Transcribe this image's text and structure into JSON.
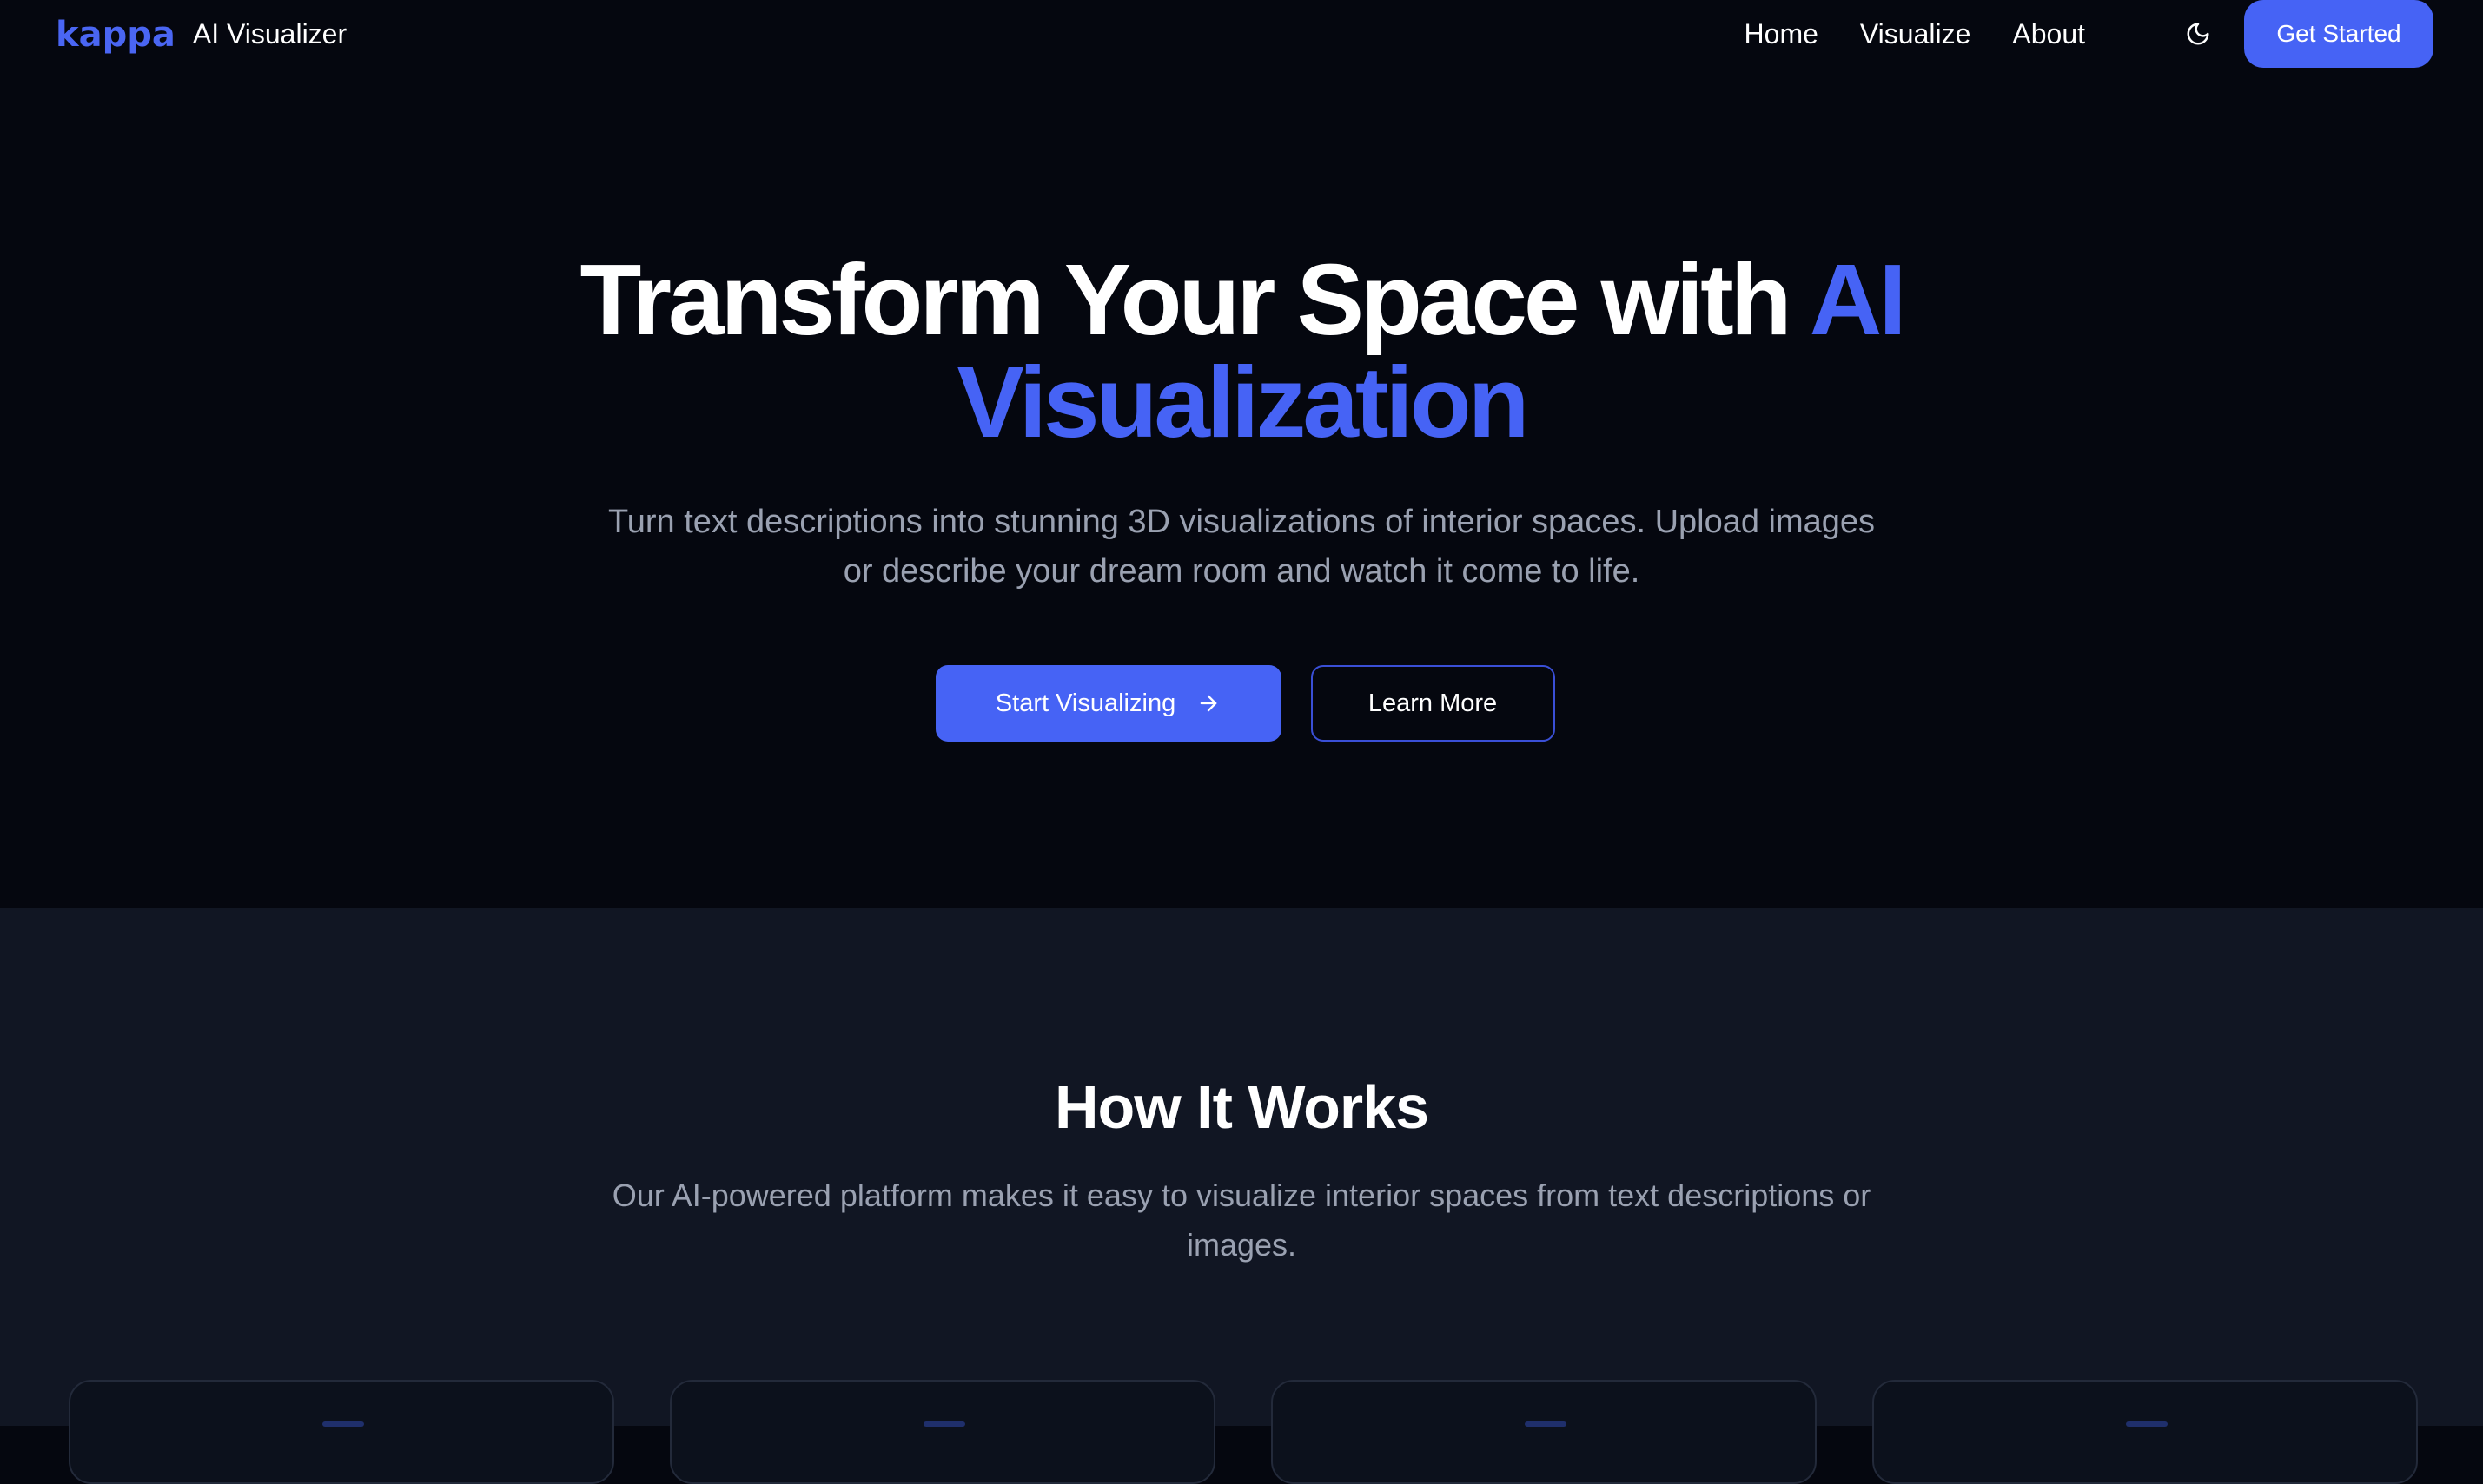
{
  "brand": {
    "logo_text": "kappa",
    "name": "AI Visualizer"
  },
  "nav": {
    "links": [
      {
        "label": "Home"
      },
      {
        "label": "Visualize"
      },
      {
        "label": "About"
      }
    ],
    "theme_toggle_icon": "moon-icon",
    "cta_label": "Get Started"
  },
  "hero": {
    "title_part1": "Transform Your Space with",
    "title_accent_part1": "AI",
    "title_accent_part2": "Visualization",
    "subtitle_line1": "Turn text descriptions into stunning 3D visualizations of interior spaces. Upload images",
    "subtitle_line2": "or describe your dream room and watch it come to life.",
    "primary_button_label": "Start Visualizing",
    "primary_button_icon": "arrow-right-icon",
    "secondary_button_label": "Learn More"
  },
  "how_it_works": {
    "title": "How It Works",
    "subtitle_line1": "Our AI-powered platform makes it easy to visualize interior spaces from text descriptions or",
    "subtitle_line2": "images."
  },
  "colors": {
    "background": "#05070f",
    "section_background": "#111623",
    "accent": "#4663f5",
    "muted_text": "#9aa1b1"
  }
}
